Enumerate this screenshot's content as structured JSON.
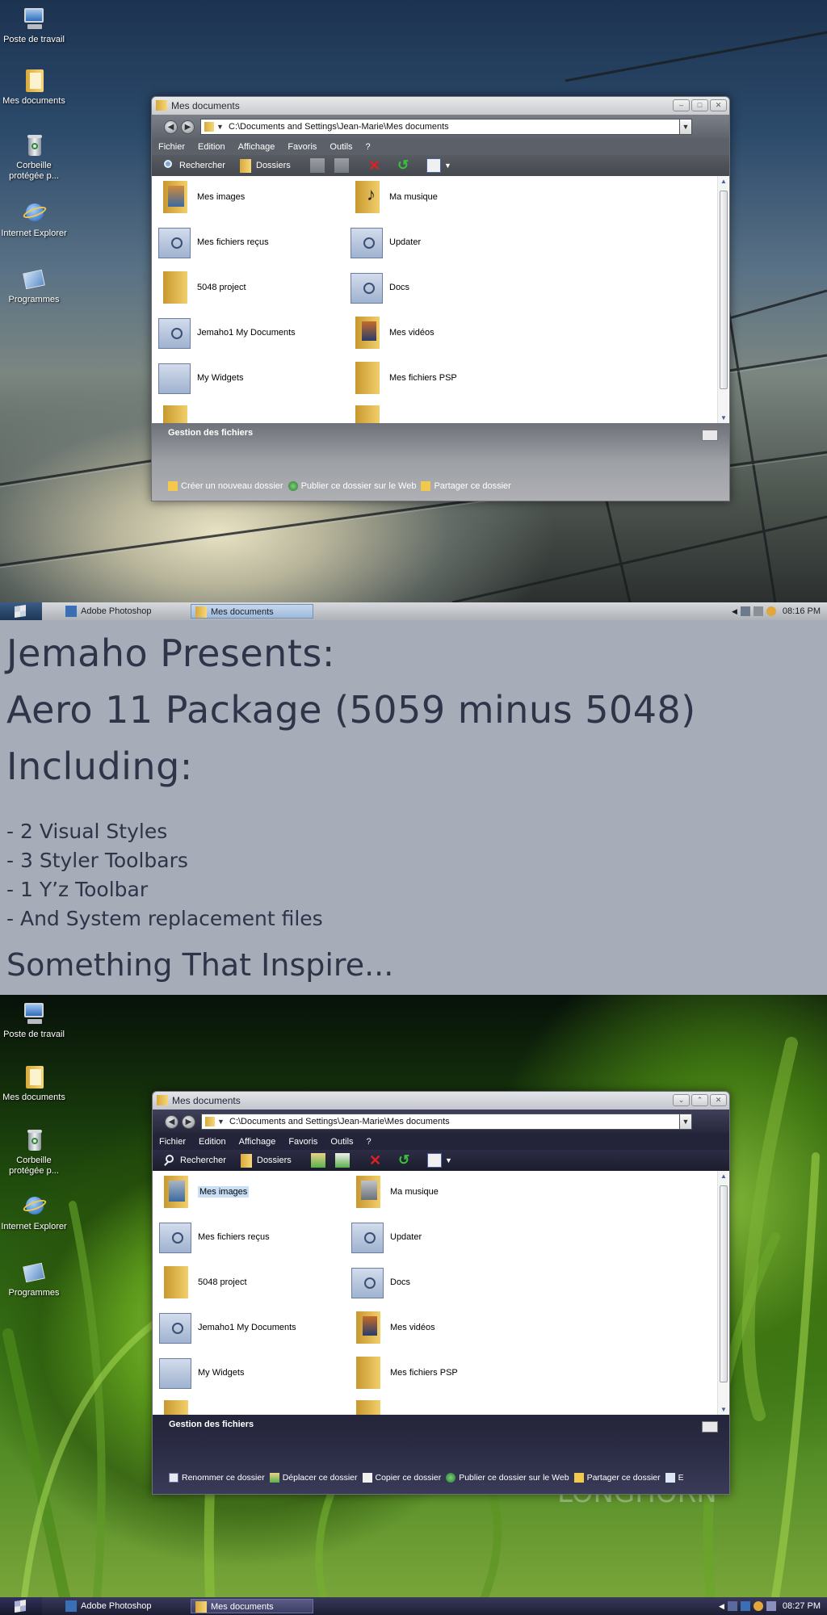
{
  "desktop_icons": [
    {
      "label": "Poste de travail",
      "icon": "computer-icon"
    },
    {
      "label": "Mes documents",
      "icon": "folder-icon"
    },
    {
      "label": "Corbeille protégée p...",
      "icon": "recycle-bin-icon"
    },
    {
      "label": "Internet Explorer",
      "icon": "internet-explorer-icon"
    },
    {
      "label": "Programmes",
      "icon": "programs-icon"
    }
  ],
  "window": {
    "title": "Mes documents",
    "address": "C:\\Documents and Settings\\Jean-Marie\\Mes documents",
    "menu": [
      "Fichier",
      "Edition",
      "Affichage",
      "Favoris",
      "Outils",
      "?"
    ],
    "toolbar": {
      "search": "Rechercher",
      "folders": "Dossiers"
    },
    "items_left": [
      "Mes images",
      "Mes fichiers reçus",
      "5048 project",
      "Jemaho1 My Documents",
      "My Widgets"
    ],
    "items_right": [
      "Ma musique",
      "Updater",
      "Docs",
      "Mes vidéos",
      "Mes fichiers PSP"
    ],
    "task_pane_title": "Gestion des fichiers",
    "task_links_top": [
      "Créer un nouveau dossier",
      "Publier ce dossier sur le Web",
      "Partager ce dossier"
    ],
    "task_links_bottom": [
      "Renommer ce dossier",
      "Déplacer ce dossier",
      "Copier ce dossier",
      "Publier ce dossier sur le Web",
      "Partager ce dossier",
      "E"
    ]
  },
  "taskbar_top": {
    "tasks": [
      "Adobe Photoshop",
      "Mes documents"
    ],
    "clock": "08:16 PM"
  },
  "taskbar_bottom": {
    "tasks": [
      "Adobe Photoshop",
      "Mes documents"
    ],
    "clock": "08:27 PM"
  },
  "banner": {
    "line1": "Jemaho Presents:",
    "line2": "Aero 11 Package (5059 minus 5048)",
    "line3": "Including:",
    "items": [
      "- 2 Visual Styles",
      "- 3 Styler Toolbars",
      "- 1 Y’z Toolbar",
      "- And System replacement files"
    ],
    "slogan": "Something That Inspire..."
  },
  "watermark": "LONGHORN",
  "colors": {
    "banner_bg": "#a6acb8",
    "banner_text": "#2f3448",
    "selection": "#c9dff5"
  }
}
